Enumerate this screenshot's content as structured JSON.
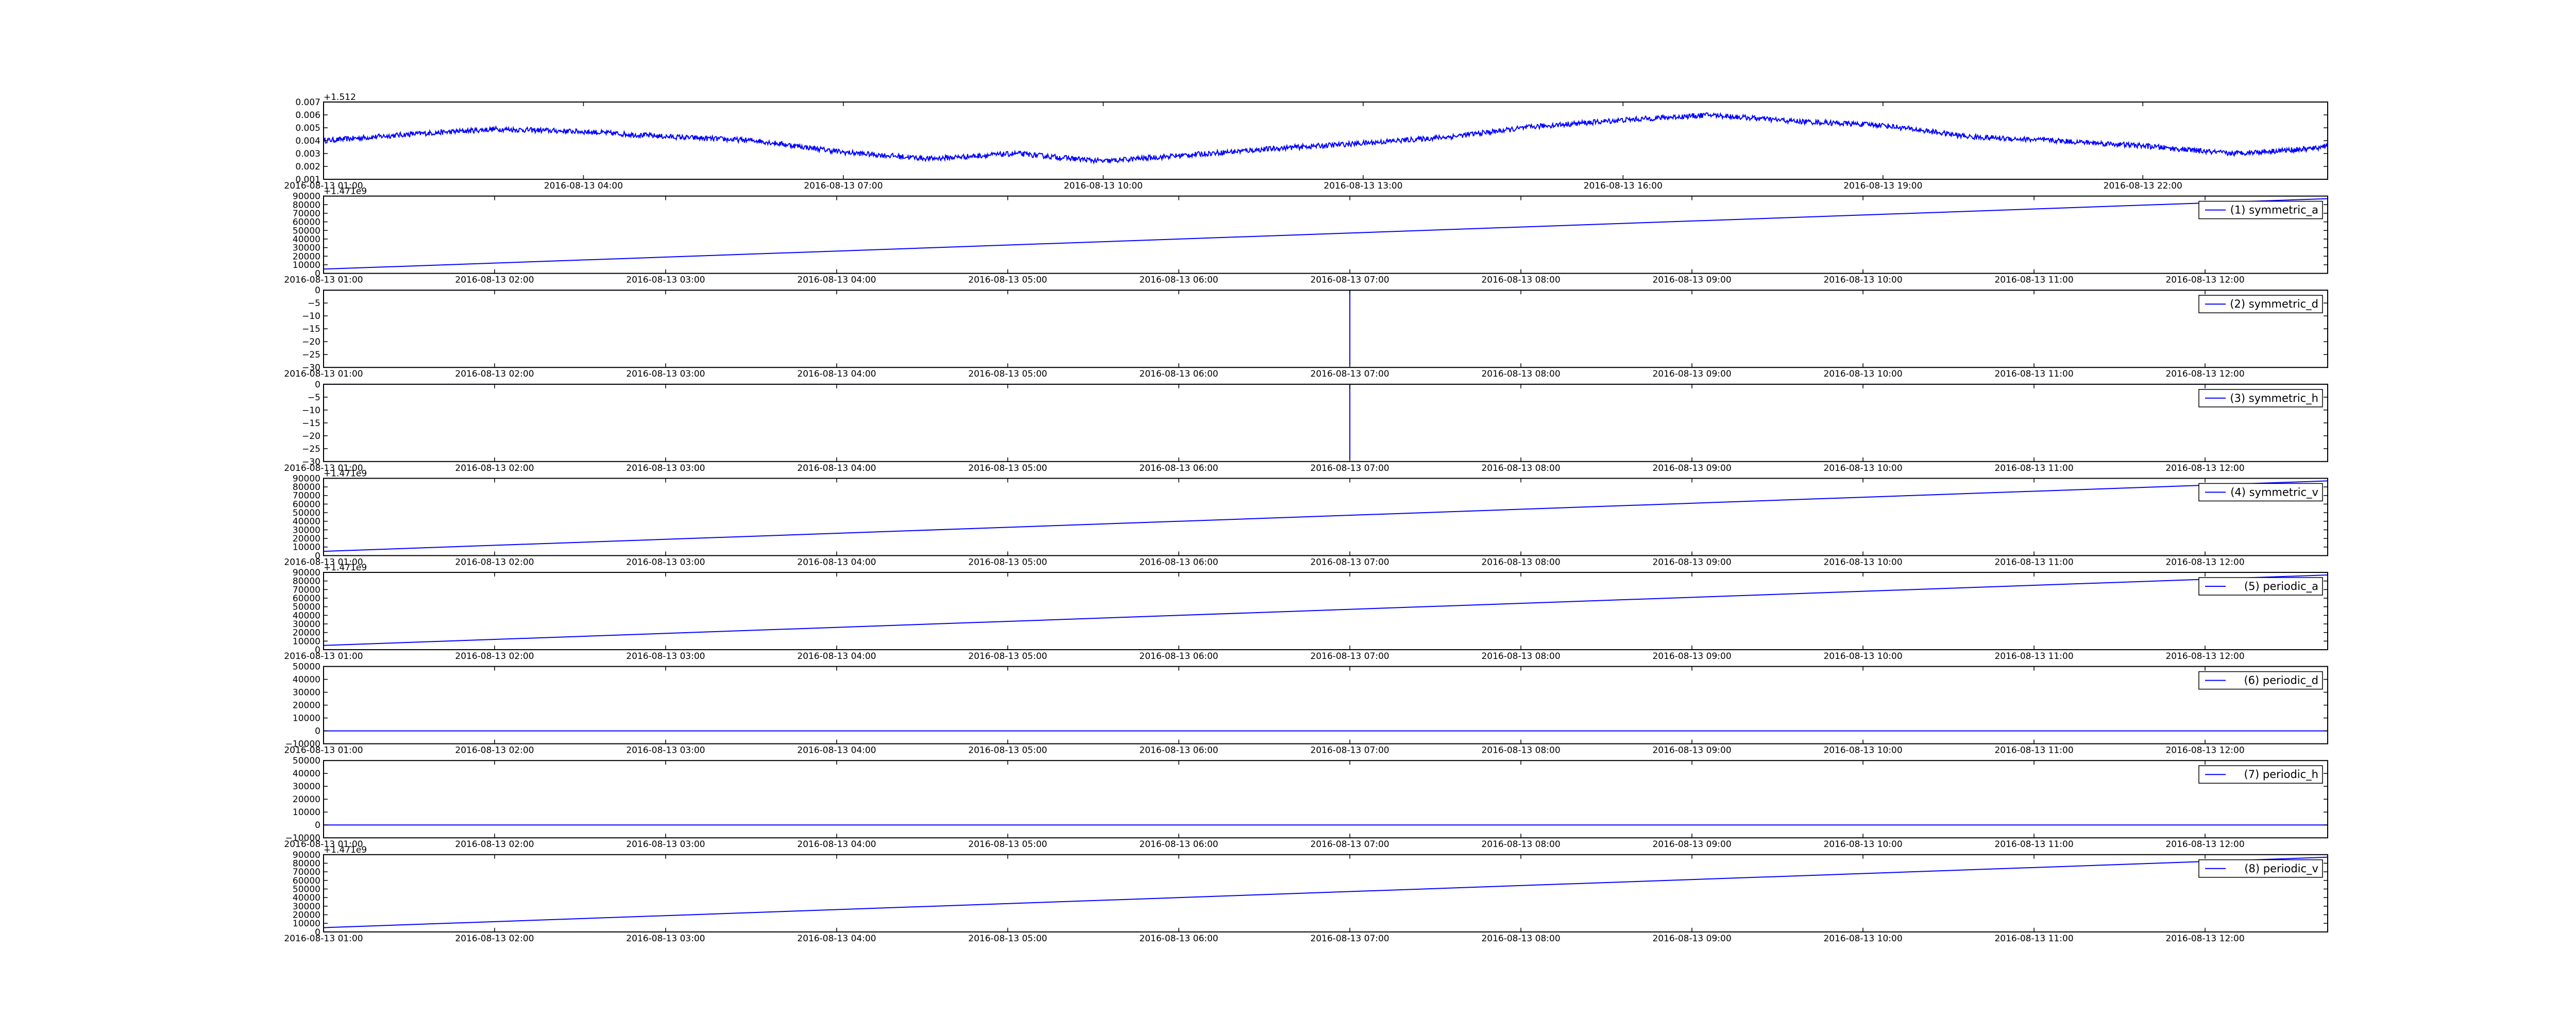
{
  "figure": {
    "background": "#ffffff",
    "line_color": "#0000ff",
    "axes_color": "#000000"
  },
  "chart_data": [
    {
      "type": "line",
      "title": "",
      "xlabel": "",
      "ylabel": "",
      "y_offset_label": "+1.512",
      "x_range": [
        "2016-08-13 01:00",
        "2016-08-14 00:08"
      ],
      "x_tick_labels": [
        "2016-08-13 01:00",
        "2016-08-13 04:00",
        "2016-08-13 07:00",
        "2016-08-13 10:00",
        "2016-08-13 13:00",
        "2016-08-13 16:00",
        "2016-08-13 19:00",
        "2016-08-13 22:00"
      ],
      "ylim": [
        0.001,
        0.007
      ],
      "y_tick_labels": [
        "0.001",
        "0.002",
        "0.003",
        "0.004",
        "0.005",
        "0.006",
        "0.007"
      ],
      "noise": 0.0004,
      "series": [
        {
          "color": "#0000ff",
          "x": [
            "2016-08-13 01:00",
            "2016-08-13 02:00",
            "2016-08-13 03:00",
            "2016-08-13 04:00",
            "2016-08-13 05:00",
            "2016-08-13 06:00",
            "2016-08-13 07:00",
            "2016-08-13 08:00",
            "2016-08-13 09:00",
            "2016-08-13 10:00",
            "2016-08-13 11:00",
            "2016-08-13 12:00",
            "2016-08-13 13:00",
            "2016-08-13 14:00",
            "2016-08-13 15:00",
            "2016-08-13 16:00",
            "2016-08-13 17:00",
            "2016-08-13 18:00",
            "2016-08-13 19:00",
            "2016-08-13 20:00",
            "2016-08-13 21:00",
            "2016-08-13 22:00",
            "2016-08-13 23:00",
            "2016-08-14 00:00",
            "2016-08-14 00:08"
          ],
          "y": [
            0.004,
            0.0045,
            0.0049,
            0.0047,
            0.0043,
            0.004,
            0.0031,
            0.0026,
            0.003,
            0.0024,
            0.0029,
            0.0034,
            0.0038,
            0.0043,
            0.0051,
            0.0056,
            0.006,
            0.0055,
            0.0052,
            0.0043,
            0.004,
            0.0036,
            0.003,
            0.0034,
            0.0037
          ]
        }
      ]
    },
    {
      "type": "line",
      "title": "",
      "xlabel": "",
      "ylabel": "",
      "y_offset_label": "+1.471e9",
      "x_range": [
        "2016-08-13 01:00",
        "2016-08-13 12:43"
      ],
      "x_tick_labels": [
        "2016-08-13 01:00",
        "2016-08-13 02:00",
        "2016-08-13 03:00",
        "2016-08-13 04:00",
        "2016-08-13 05:00",
        "2016-08-13 06:00",
        "2016-08-13 07:00",
        "2016-08-13 08:00",
        "2016-08-13 09:00",
        "2016-08-13 10:00",
        "2016-08-13 11:00",
        "2016-08-13 12:00"
      ],
      "ylim": [
        0,
        90000
      ],
      "y_tick_labels": [
        "0",
        "10000",
        "20000",
        "30000",
        "40000",
        "50000",
        "60000",
        "70000",
        "80000",
        "90000"
      ],
      "legend": "(1) symmetric_a",
      "legend_position": "upper right",
      "series": [
        {
          "name": "(1) symmetric_a",
          "color": "#0000ff",
          "x": [
            "2016-08-13 01:00",
            "2016-08-13 12:43"
          ],
          "y": [
            5000,
            87000
          ]
        }
      ]
    },
    {
      "type": "line",
      "title": "",
      "xlabel": "",
      "ylabel": "",
      "x_range": [
        "2016-08-13 01:00",
        "2016-08-13 12:43"
      ],
      "x_tick_labels": [
        "2016-08-13 01:00",
        "2016-08-13 02:00",
        "2016-08-13 03:00",
        "2016-08-13 04:00",
        "2016-08-13 05:00",
        "2016-08-13 06:00",
        "2016-08-13 07:00",
        "2016-08-13 08:00",
        "2016-08-13 09:00",
        "2016-08-13 10:00",
        "2016-08-13 11:00",
        "2016-08-13 12:00"
      ],
      "ylim": [
        -30,
        0
      ],
      "y_tick_labels": [
        "0",
        "−5",
        "−10",
        "−15",
        "−20",
        "−25",
        "−30"
      ],
      "legend": "(2) symmetric_d",
      "legend_position": "upper right",
      "series": [
        {
          "name": "(2) symmetric_d",
          "color": "#0000ff",
          "x": [
            "2016-08-13 01:00",
            "2016-08-13 07:00",
            "2016-08-13 07:00",
            "2016-08-13 07:00",
            "2016-08-13 12:43"
          ],
          "y": [
            0,
            0,
            -29,
            0,
            0
          ]
        }
      ]
    },
    {
      "type": "line",
      "title": "",
      "xlabel": "",
      "ylabel": "",
      "x_range": [
        "2016-08-13 01:00",
        "2016-08-13 12:43"
      ],
      "x_tick_labels": [
        "2016-08-13 01:00",
        "2016-08-13 02:00",
        "2016-08-13 03:00",
        "2016-08-13 04:00",
        "2016-08-13 05:00",
        "2016-08-13 06:00",
        "2016-08-13 07:00",
        "2016-08-13 08:00",
        "2016-08-13 09:00",
        "2016-08-13 10:00",
        "2016-08-13 11:00",
        "2016-08-13 12:00"
      ],
      "ylim": [
        -30,
        0
      ],
      "y_tick_labels": [
        "0",
        "−5",
        "−10",
        "−15",
        "−20",
        "−25",
        "−30"
      ],
      "legend": "(3) symmetric_h",
      "legend_position": "upper right",
      "series": [
        {
          "name": "(3) symmetric_h",
          "color": "#0000ff",
          "x": [
            "2016-08-13 01:00",
            "2016-08-13 07:00",
            "2016-08-13 07:00",
            "2016-08-13 07:00",
            "2016-08-13 12:43"
          ],
          "y": [
            0,
            0,
            -29,
            0,
            0
          ]
        }
      ]
    },
    {
      "type": "line",
      "title": "",
      "xlabel": "",
      "ylabel": "",
      "y_offset_label": "+1.471e9",
      "x_range": [
        "2016-08-13 01:00",
        "2016-08-13 12:43"
      ],
      "x_tick_labels": [
        "2016-08-13 01:00",
        "2016-08-13 02:00",
        "2016-08-13 03:00",
        "2016-08-13 04:00",
        "2016-08-13 05:00",
        "2016-08-13 06:00",
        "2016-08-13 07:00",
        "2016-08-13 08:00",
        "2016-08-13 09:00",
        "2016-08-13 10:00",
        "2016-08-13 11:00",
        "2016-08-13 12:00"
      ],
      "ylim": [
        0,
        90000
      ],
      "y_tick_labels": [
        "0",
        "10000",
        "20000",
        "30000",
        "40000",
        "50000",
        "60000",
        "70000",
        "80000",
        "90000"
      ],
      "legend": "(4) symmetric_v",
      "legend_position": "upper right",
      "series": [
        {
          "name": "(4) symmetric_v",
          "color": "#0000ff",
          "x": [
            "2016-08-13 01:00",
            "2016-08-13 12:43"
          ],
          "y": [
            5000,
            87000
          ]
        }
      ]
    },
    {
      "type": "line",
      "title": "",
      "xlabel": "",
      "ylabel": "",
      "y_offset_label": "+1.471e9",
      "x_range": [
        "2016-08-13 01:00",
        "2016-08-13 12:43"
      ],
      "x_tick_labels": [
        "2016-08-13 01:00",
        "2016-08-13 02:00",
        "2016-08-13 03:00",
        "2016-08-13 04:00",
        "2016-08-13 05:00",
        "2016-08-13 06:00",
        "2016-08-13 07:00",
        "2016-08-13 08:00",
        "2016-08-13 09:00",
        "2016-08-13 10:00",
        "2016-08-13 11:00",
        "2016-08-13 12:00"
      ],
      "ylim": [
        0,
        90000
      ],
      "y_tick_labels": [
        "0",
        "10000",
        "20000",
        "30000",
        "40000",
        "50000",
        "60000",
        "70000",
        "80000",
        "90000"
      ],
      "legend": "(5) periodic_a",
      "legend_position": "upper right",
      "series": [
        {
          "name": "(5) periodic_a",
          "color": "#0000ff",
          "x": [
            "2016-08-13 01:00",
            "2016-08-13 12:43"
          ],
          "y": [
            5000,
            87000
          ]
        }
      ]
    },
    {
      "type": "line",
      "title": "",
      "xlabel": "",
      "ylabel": "",
      "x_range": [
        "2016-08-13 01:00",
        "2016-08-13 12:43"
      ],
      "x_tick_labels": [
        "2016-08-13 01:00",
        "2016-08-13 02:00",
        "2016-08-13 03:00",
        "2016-08-13 04:00",
        "2016-08-13 05:00",
        "2016-08-13 06:00",
        "2016-08-13 07:00",
        "2016-08-13 08:00",
        "2016-08-13 09:00",
        "2016-08-13 10:00",
        "2016-08-13 11:00",
        "2016-08-13 12:00"
      ],
      "ylim": [
        -10000,
        50000
      ],
      "y_tick_labels": [
        "−10000",
        "0",
        "10000",
        "20000",
        "30000",
        "40000",
        "50000"
      ],
      "legend": "(6) periodic_d",
      "legend_position": "upper right",
      "series": [
        {
          "name": "(6) periodic_d",
          "color": "#0000ff",
          "x": [
            "2016-08-13 01:00",
            "2016-08-13 12:43"
          ],
          "y": [
            0,
            0
          ]
        }
      ]
    },
    {
      "type": "line",
      "title": "",
      "xlabel": "",
      "ylabel": "",
      "x_range": [
        "2016-08-13 01:00",
        "2016-08-13 12:43"
      ],
      "x_tick_labels": [
        "2016-08-13 01:00",
        "2016-08-13 02:00",
        "2016-08-13 03:00",
        "2016-08-13 04:00",
        "2016-08-13 05:00",
        "2016-08-13 06:00",
        "2016-08-13 07:00",
        "2016-08-13 08:00",
        "2016-08-13 09:00",
        "2016-08-13 10:00",
        "2016-08-13 11:00",
        "2016-08-13 12:00"
      ],
      "ylim": [
        -10000,
        50000
      ],
      "y_tick_labels": [
        "−10000",
        "0",
        "10000",
        "20000",
        "30000",
        "40000",
        "50000"
      ],
      "legend": "(7) periodic_h",
      "legend_position": "upper right",
      "series": [
        {
          "name": "(7) periodic_h",
          "color": "#0000ff",
          "x": [
            "2016-08-13 01:00",
            "2016-08-13 12:43"
          ],
          "y": [
            0,
            0
          ]
        }
      ]
    },
    {
      "type": "line",
      "title": "",
      "xlabel": "",
      "ylabel": "",
      "y_offset_label": "+1.471e9",
      "x_range": [
        "2016-08-13 01:00",
        "2016-08-13 12:43"
      ],
      "x_tick_labels": [
        "2016-08-13 01:00",
        "2016-08-13 02:00",
        "2016-08-13 03:00",
        "2016-08-13 04:00",
        "2016-08-13 05:00",
        "2016-08-13 06:00",
        "2016-08-13 07:00",
        "2016-08-13 08:00",
        "2016-08-13 09:00",
        "2016-08-13 10:00",
        "2016-08-13 11:00",
        "2016-08-13 12:00"
      ],
      "ylim": [
        0,
        90000
      ],
      "y_tick_labels": [
        "0",
        "10000",
        "20000",
        "30000",
        "40000",
        "50000",
        "60000",
        "70000",
        "80000",
        "90000"
      ],
      "legend": "(8) periodic_v",
      "legend_position": "upper right",
      "series": [
        {
          "name": "(8) periodic_v",
          "color": "#0000ff",
          "x": [
            "2016-08-13 01:00",
            "2016-08-13 12:43"
          ],
          "y": [
            5000,
            87000
          ]
        }
      ]
    }
  ]
}
